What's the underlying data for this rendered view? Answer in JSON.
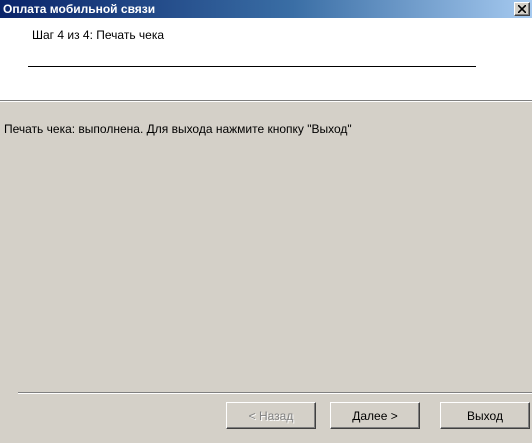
{
  "window": {
    "title": "Оплата мобильной связи",
    "close_symbol": "×"
  },
  "header": {
    "step_title": "Шаг 4 из 4: Печать чека"
  },
  "main": {
    "message": "Печать чека: выполнена. Для выхода нажмите кнопку \"Выход\""
  },
  "footer": {
    "back_label": "< Назад",
    "back_enabled": false,
    "next_label": "Далее >",
    "exit_label": "Выход"
  },
  "colors": {
    "titlebar_start": "#0a246a",
    "titlebar_end": "#a6caf0",
    "face": "#d4d0c8",
    "header_bg": "#ffffff",
    "disabled_text": "#808080"
  },
  "icons": {
    "close": "close-icon"
  }
}
